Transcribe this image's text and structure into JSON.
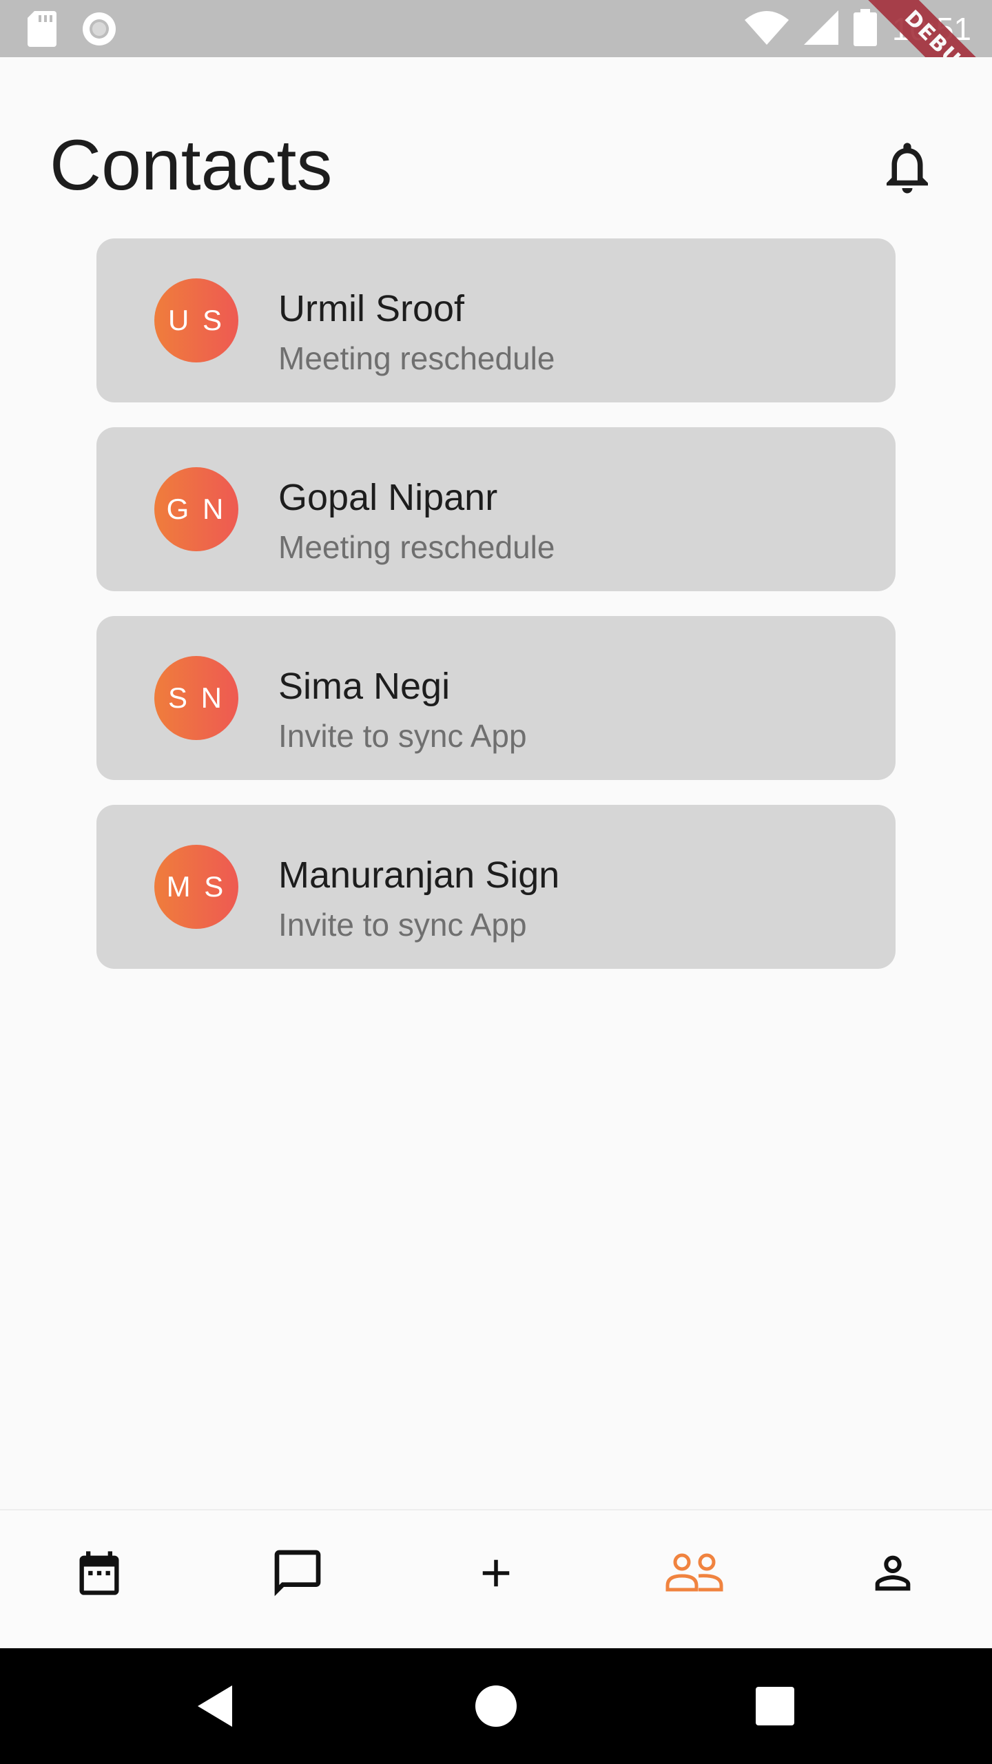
{
  "status_bar": {
    "time": "10:51",
    "debug_label": "DEBUG",
    "icons": [
      "sd-card-icon",
      "record-icon",
      "wifi-icon",
      "signal-icon",
      "battery-icon"
    ]
  },
  "header": {
    "title": "Contacts",
    "notification_icon": "bell-icon"
  },
  "contacts": [
    {
      "initials": "U S",
      "name": "Urmil Sroof",
      "subtitle": "Meeting reschedule"
    },
    {
      "initials": "G N",
      "name": "Gopal Nipanr",
      "subtitle": "Meeting reschedule"
    },
    {
      "initials": "S N",
      "name": "Sima Negi",
      "subtitle": "Invite to sync App"
    },
    {
      "initials": "M S",
      "name": "Manuranjan Sign",
      "subtitle": "Invite to sync App"
    }
  ],
  "bottom_nav": {
    "items": [
      {
        "icon": "calendar-icon",
        "active": false
      },
      {
        "icon": "chat-icon",
        "active": false
      },
      {
        "icon": "plus-icon",
        "active": false
      },
      {
        "icon": "people-icon",
        "active": true
      },
      {
        "icon": "person-icon",
        "active": false
      }
    ]
  },
  "system_nav": [
    "back-icon",
    "home-icon",
    "recents-icon"
  ],
  "colors": {
    "accent": "#f0833f",
    "avatar_gradient_start": "#ef7d3c",
    "avatar_gradient_end": "#ee5a52",
    "card_background": "#d6d6d6",
    "page_background": "#fafafa",
    "status_bar": "#bdbdbd",
    "debug_banner": "#a4313d"
  }
}
